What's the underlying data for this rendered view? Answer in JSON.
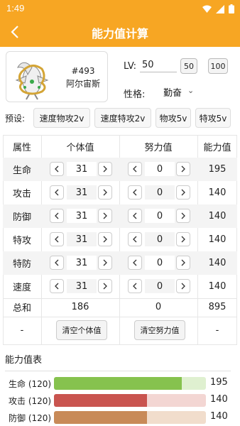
{
  "status_bar": {
    "time": "1:49"
  },
  "app_bar": {
    "title": "能力值计算"
  },
  "pokemon": {
    "number": "#493",
    "name": "阿尔宙斯"
  },
  "level": {
    "label": "LV:",
    "value": "50",
    "quick_buttons": [
      "50",
      "100"
    ]
  },
  "nature": {
    "label": "性格:",
    "value": "勤奋"
  },
  "presets": {
    "label": "预设:",
    "buttons": [
      "速度物攻2v",
      "速度特攻2v",
      "物攻5v",
      "特攻5v"
    ]
  },
  "table": {
    "headers": [
      "属性",
      "个体值",
      "努力值",
      "能力值"
    ],
    "rows": [
      {
        "stat": "生命",
        "iv": "31",
        "ev": "0",
        "value": "195"
      },
      {
        "stat": "攻击",
        "iv": "31",
        "ev": "0",
        "value": "140"
      },
      {
        "stat": "防御",
        "iv": "31",
        "ev": "0",
        "value": "140"
      },
      {
        "stat": "特攻",
        "iv": "31",
        "ev": "0",
        "value": "140"
      },
      {
        "stat": "特防",
        "iv": "31",
        "ev": "0",
        "value": "140"
      },
      {
        "stat": "速度",
        "iv": "31",
        "ev": "0",
        "value": "140"
      }
    ],
    "total": {
      "label": "总和",
      "iv": "186",
      "ev": "0",
      "value": "895"
    },
    "action_row": {
      "dash": "-",
      "clear_iv": "清空个体值",
      "clear_ev": "清空努力值"
    }
  },
  "chart_title": "能力值表",
  "chart_data": {
    "type": "bar",
    "categories": [
      "生命",
      "攻击",
      "防御"
    ],
    "base_labels": [
      "(120)",
      "(120)",
      "(120)"
    ],
    "values": [
      195,
      140,
      140
    ],
    "fill_fractions": [
      0.84,
      0.61,
      0.61
    ],
    "colors": [
      "#86c24e",
      "#c9544f",
      "#c88a58"
    ],
    "track_colors": [
      "#dff0d0",
      "#f3d6d3",
      "#f1ddcc"
    ]
  },
  "colors": {
    "accent": "#f7a623"
  }
}
